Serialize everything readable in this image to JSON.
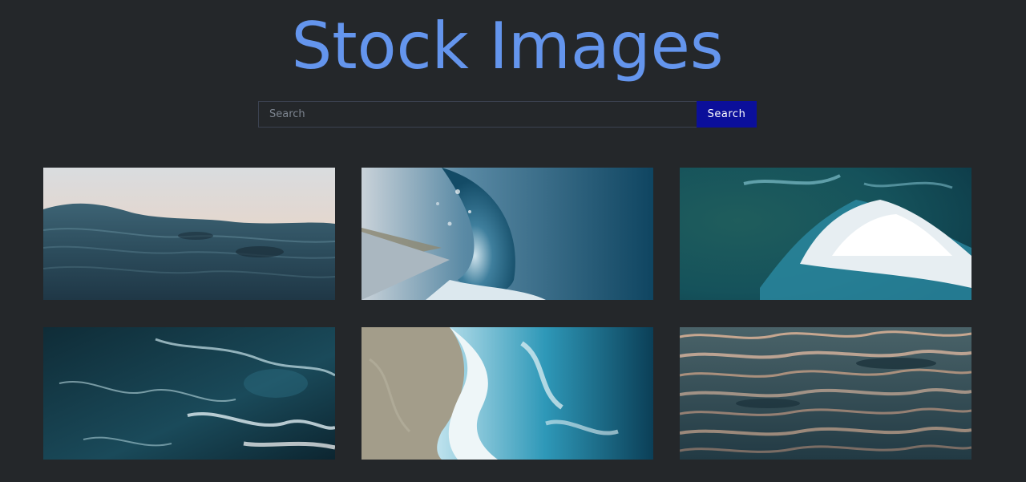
{
  "header": {
    "title": "Stock Images"
  },
  "search": {
    "placeholder": "Search",
    "value": "",
    "button_label": "Search"
  },
  "gallery": {
    "items": [
      {
        "subject": "calm-sea-at-dusk"
      },
      {
        "subject": "barreling-wave"
      },
      {
        "subject": "aerial-breaking-wave"
      },
      {
        "subject": "dark-sea-foam"
      },
      {
        "subject": "wave-on-sandy-shore"
      },
      {
        "subject": "rippled-water-sunset"
      }
    ]
  },
  "colors": {
    "background": "#24272a",
    "title": "#6495ed",
    "search_button": "#0b0f9a"
  }
}
